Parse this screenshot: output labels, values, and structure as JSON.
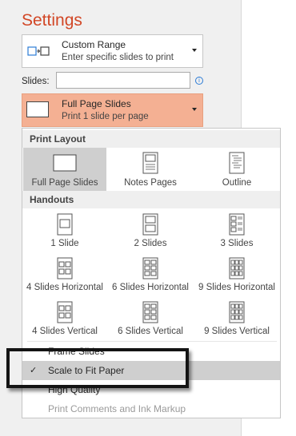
{
  "header": {
    "title": "Settings"
  },
  "range_dropdown": {
    "title": "Custom Range",
    "subtitle": "Enter specific slides to print",
    "icon": "custom-range-icon"
  },
  "slides_field": {
    "label": "Slides:",
    "value": "",
    "info_glyph": "i"
  },
  "layout_dropdown": {
    "title": "Full Page Slides",
    "subtitle": "Print 1 slide per page",
    "highlight_color": "#f4b093"
  },
  "menu": {
    "print_layout": {
      "header": "Print Layout",
      "options": [
        {
          "label": "Full Page Slides",
          "selected": true
        },
        {
          "label": "Notes Pages",
          "selected": false
        },
        {
          "label": "Outline",
          "selected": false
        }
      ]
    },
    "handouts": {
      "header": "Handouts",
      "options": [
        {
          "label": "1 Slide"
        },
        {
          "label": "2 Slides"
        },
        {
          "label": "3 Slides"
        },
        {
          "label": "4 Slides Horizontal"
        },
        {
          "label": "6 Slides Horizontal"
        },
        {
          "label": "9 Slides Horizontal"
        },
        {
          "label": "4 Slides Vertical"
        },
        {
          "label": "6 Slides Vertical"
        },
        {
          "label": "9 Slides Vertical"
        }
      ]
    },
    "items": [
      {
        "label": "Frame Slides",
        "checked": false,
        "disabled": false
      },
      {
        "label": "Scale to Fit Paper",
        "checked": true,
        "disabled": false
      },
      {
        "label": "High Quality",
        "checked": false,
        "disabled": false
      },
      {
        "label": "Print Comments and Ink Markup",
        "checked": false,
        "disabled": true
      }
    ],
    "check_glyph": "✓"
  },
  "colors": {
    "accent": "#d24726",
    "selection": "#cfcfcf",
    "callout_border": "#141414"
  }
}
